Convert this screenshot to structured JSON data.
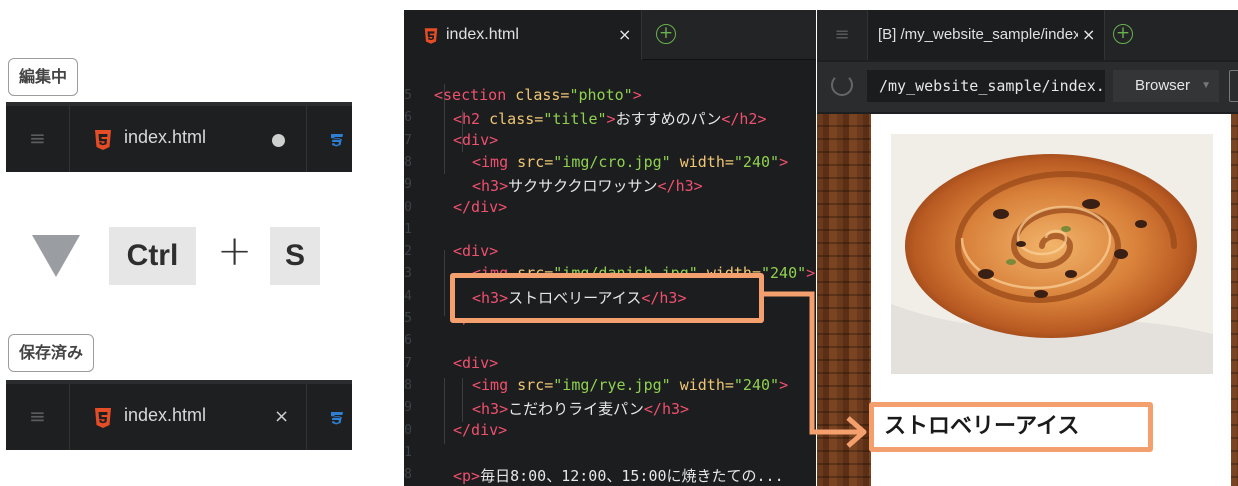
{
  "left": {
    "before_label": "編集中",
    "after_label": "保存済み",
    "shortcut": {
      "key1": "Ctrl",
      "plus": "+",
      "key2": "S"
    },
    "tab_unsaved": {
      "filename": "index.html",
      "state_icon": "unsaved-dot-icon"
    },
    "tab_saved": {
      "filename": "index.html",
      "close": "×"
    }
  },
  "editor": {
    "tab": {
      "filename": "index.html",
      "close": "×",
      "add": "+"
    },
    "code_lines": [
      {
        "indent": 0,
        "parts": [
          [
            "tg",
            "<section "
          ],
          [
            "at",
            "class="
          ],
          [
            "st",
            "\"photo\""
          ],
          [
            "tg",
            ">"
          ]
        ]
      },
      {
        "indent": 1,
        "parts": [
          [
            "tg",
            "<h2 "
          ],
          [
            "at",
            "class="
          ],
          [
            "st",
            "\"title\""
          ],
          [
            "tg",
            ">"
          ],
          [
            "tx",
            "おすすめのパン"
          ],
          [
            "tg",
            "</h2>"
          ]
        ]
      },
      {
        "indent": 1,
        "parts": [
          [
            "tg",
            "<div>"
          ]
        ]
      },
      {
        "indent": 2,
        "parts": [
          [
            "tg",
            "<img "
          ],
          [
            "at",
            "src="
          ],
          [
            "st",
            "\"img/cro.jpg\""
          ],
          [
            "tx",
            " "
          ],
          [
            "at",
            "width="
          ],
          [
            "st",
            "\"240\""
          ],
          [
            "tg",
            ">"
          ]
        ]
      },
      {
        "indent": 2,
        "parts": [
          [
            "tg",
            "<h3>"
          ],
          [
            "tx",
            "サクサククロワッサン"
          ],
          [
            "tg",
            "</h3>"
          ]
        ]
      },
      {
        "indent": 1,
        "parts": [
          [
            "tg",
            "</div>"
          ]
        ]
      },
      {
        "indent": 0,
        "parts": []
      },
      {
        "indent": 1,
        "parts": [
          [
            "tg",
            "<div>"
          ]
        ]
      },
      {
        "indent": 2,
        "parts": [
          [
            "tg",
            "<img "
          ],
          [
            "at",
            "src="
          ],
          [
            "st",
            "\"img/danish.jpg\""
          ],
          [
            "tx",
            " "
          ],
          [
            "at",
            "width="
          ],
          [
            "st",
            "\"240\""
          ],
          [
            "tg",
            ">"
          ]
        ]
      },
      {
        "indent": 2,
        "parts": [
          [
            "tg",
            "<h3>"
          ],
          [
            "tx",
            "ストロベリーアイス"
          ],
          [
            "tg",
            "</h3>"
          ]
        ]
      },
      {
        "indent": 1,
        "parts": [
          [
            "tg",
            "</div>"
          ]
        ]
      },
      {
        "indent": 0,
        "parts": []
      },
      {
        "indent": 1,
        "parts": [
          [
            "tg",
            "<div>"
          ]
        ]
      },
      {
        "indent": 2,
        "parts": [
          [
            "tg",
            "<img "
          ],
          [
            "at",
            "src="
          ],
          [
            "st",
            "\"img/rye.jpg\""
          ],
          [
            "tx",
            " "
          ],
          [
            "at",
            "width="
          ],
          [
            "st",
            "\"240\""
          ],
          [
            "tg",
            ">"
          ]
        ]
      },
      {
        "indent": 2,
        "parts": [
          [
            "tg",
            "<h3>"
          ],
          [
            "tx",
            "こだわりライ麦パン"
          ],
          [
            "tg",
            "</h3>"
          ]
        ]
      },
      {
        "indent": 1,
        "parts": [
          [
            "tg",
            "</div>"
          ]
        ]
      },
      {
        "indent": 0,
        "parts": []
      },
      {
        "indent": 1,
        "parts": [
          [
            "tg",
            "<p>"
          ],
          [
            "tx",
            "毎日8:00、12:00、15:00に焼きたての..."
          ]
        ]
      }
    ],
    "line_numbers": [
      "5",
      "6",
      "7",
      "8",
      "9",
      "0",
      "1",
      "2",
      "3",
      "4",
      "5",
      "6",
      "7",
      "8",
      "9",
      "0",
      "1",
      "8"
    ]
  },
  "preview": {
    "tab": {
      "title": "[B] /my_website_sample/index.html",
      "close": "×",
      "add": "+"
    },
    "url": "/my_website_sample/index.html",
    "mode": "Browser",
    "heading": "ストロベリーアイス"
  },
  "colors": {
    "highlight": "#f4a06e",
    "html5": "#e44d26",
    "css3": "#2f7fd1",
    "add_green": "#6ab04c"
  }
}
